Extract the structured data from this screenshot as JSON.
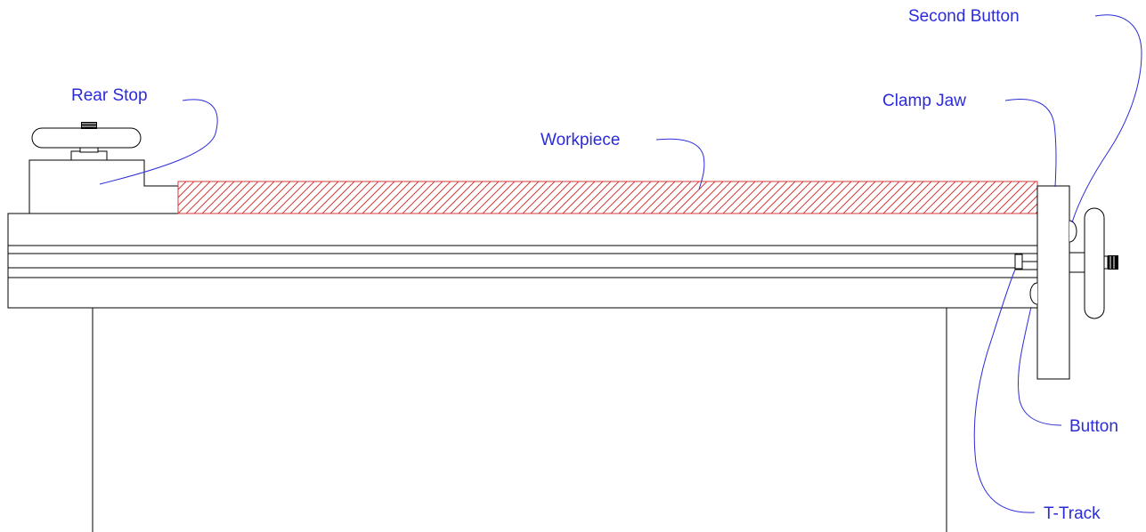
{
  "labels": {
    "rear_stop": "Rear Stop",
    "workpiece": "Workpiece",
    "clamp_jaw": "Clamp Jaw",
    "second_button": "Second Button",
    "button": "Button",
    "t_track": "T-Track"
  },
  "colors": {
    "label": "#2b2bd9",
    "hatch": "#d43b3b",
    "line": "#000000"
  }
}
